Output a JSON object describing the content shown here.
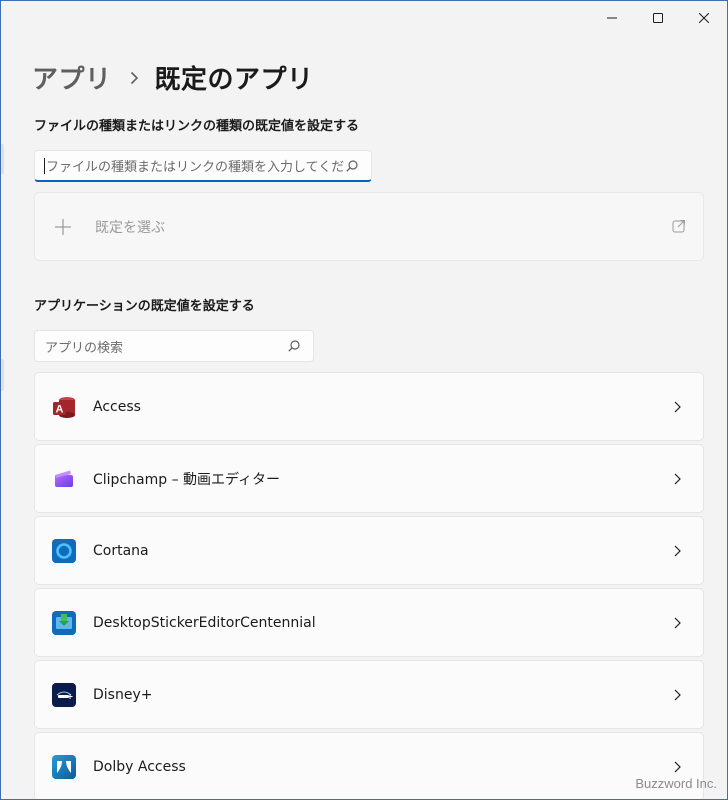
{
  "window": {
    "caption": {
      "minimize_icon": "minimize-icon",
      "maximize_icon": "maximize-icon",
      "close_icon": "close-icon"
    }
  },
  "breadcrumb": {
    "parent": "アプリ",
    "separator_icon": "chevron-right-icon",
    "current": "既定のアプリ"
  },
  "file_type_section": {
    "title": "ファイルの種類またはリンクの種類の既定値を設定する",
    "search_placeholder": "ファイルの種類またはリンクの種類を入力してください",
    "choose_default_label": "既定を選ぶ"
  },
  "app_section": {
    "title": "アプリケーションの既定値を設定する",
    "search_placeholder": "アプリの検索",
    "apps": [
      {
        "name": "Access",
        "icon": "access-icon"
      },
      {
        "name": "Clipchamp – 動画エディター",
        "icon": "clipchamp-icon"
      },
      {
        "name": "Cortana",
        "icon": "cortana-icon"
      },
      {
        "name": "DesktopStickerEditorCentennial",
        "icon": "sticker-editor-icon"
      },
      {
        "name": "Disney+",
        "icon": "disney-plus-icon"
      },
      {
        "name": "Dolby Access",
        "icon": "dolby-access-icon"
      }
    ]
  },
  "watermark": "Buzzword Inc.",
  "colors": {
    "accent": "#0067c0",
    "background": "#f3f3f3",
    "card": "#fbfbfb"
  }
}
